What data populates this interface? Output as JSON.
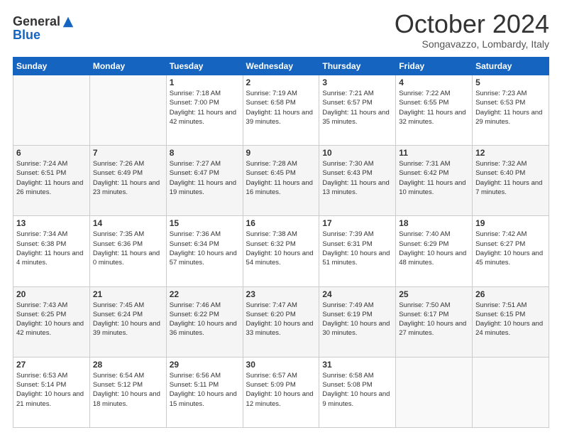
{
  "logo": {
    "general": "General",
    "blue": "Blue"
  },
  "header": {
    "month": "October 2024",
    "location": "Songavazzo, Lombardy, Italy"
  },
  "weekdays": [
    "Sunday",
    "Monday",
    "Tuesday",
    "Wednesday",
    "Thursday",
    "Friday",
    "Saturday"
  ],
  "weeks": [
    [
      {
        "day": "",
        "info": ""
      },
      {
        "day": "",
        "info": ""
      },
      {
        "day": "1",
        "info": "Sunrise: 7:18 AM\nSunset: 7:00 PM\nDaylight: 11 hours and 42 minutes."
      },
      {
        "day": "2",
        "info": "Sunrise: 7:19 AM\nSunset: 6:58 PM\nDaylight: 11 hours and 39 minutes."
      },
      {
        "day": "3",
        "info": "Sunrise: 7:21 AM\nSunset: 6:57 PM\nDaylight: 11 hours and 35 minutes."
      },
      {
        "day": "4",
        "info": "Sunrise: 7:22 AM\nSunset: 6:55 PM\nDaylight: 11 hours and 32 minutes."
      },
      {
        "day": "5",
        "info": "Sunrise: 7:23 AM\nSunset: 6:53 PM\nDaylight: 11 hours and 29 minutes."
      }
    ],
    [
      {
        "day": "6",
        "info": "Sunrise: 7:24 AM\nSunset: 6:51 PM\nDaylight: 11 hours and 26 minutes."
      },
      {
        "day": "7",
        "info": "Sunrise: 7:26 AM\nSunset: 6:49 PM\nDaylight: 11 hours and 23 minutes."
      },
      {
        "day": "8",
        "info": "Sunrise: 7:27 AM\nSunset: 6:47 PM\nDaylight: 11 hours and 19 minutes."
      },
      {
        "day": "9",
        "info": "Sunrise: 7:28 AM\nSunset: 6:45 PM\nDaylight: 11 hours and 16 minutes."
      },
      {
        "day": "10",
        "info": "Sunrise: 7:30 AM\nSunset: 6:43 PM\nDaylight: 11 hours and 13 minutes."
      },
      {
        "day": "11",
        "info": "Sunrise: 7:31 AM\nSunset: 6:42 PM\nDaylight: 11 hours and 10 minutes."
      },
      {
        "day": "12",
        "info": "Sunrise: 7:32 AM\nSunset: 6:40 PM\nDaylight: 11 hours and 7 minutes."
      }
    ],
    [
      {
        "day": "13",
        "info": "Sunrise: 7:34 AM\nSunset: 6:38 PM\nDaylight: 11 hours and 4 minutes."
      },
      {
        "day": "14",
        "info": "Sunrise: 7:35 AM\nSunset: 6:36 PM\nDaylight: 11 hours and 0 minutes."
      },
      {
        "day": "15",
        "info": "Sunrise: 7:36 AM\nSunset: 6:34 PM\nDaylight: 10 hours and 57 minutes."
      },
      {
        "day": "16",
        "info": "Sunrise: 7:38 AM\nSunset: 6:32 PM\nDaylight: 10 hours and 54 minutes."
      },
      {
        "day": "17",
        "info": "Sunrise: 7:39 AM\nSunset: 6:31 PM\nDaylight: 10 hours and 51 minutes."
      },
      {
        "day": "18",
        "info": "Sunrise: 7:40 AM\nSunset: 6:29 PM\nDaylight: 10 hours and 48 minutes."
      },
      {
        "day": "19",
        "info": "Sunrise: 7:42 AM\nSunset: 6:27 PM\nDaylight: 10 hours and 45 minutes."
      }
    ],
    [
      {
        "day": "20",
        "info": "Sunrise: 7:43 AM\nSunset: 6:25 PM\nDaylight: 10 hours and 42 minutes."
      },
      {
        "day": "21",
        "info": "Sunrise: 7:45 AM\nSunset: 6:24 PM\nDaylight: 10 hours and 39 minutes."
      },
      {
        "day": "22",
        "info": "Sunrise: 7:46 AM\nSunset: 6:22 PM\nDaylight: 10 hours and 36 minutes."
      },
      {
        "day": "23",
        "info": "Sunrise: 7:47 AM\nSunset: 6:20 PM\nDaylight: 10 hours and 33 minutes."
      },
      {
        "day": "24",
        "info": "Sunrise: 7:49 AM\nSunset: 6:19 PM\nDaylight: 10 hours and 30 minutes."
      },
      {
        "day": "25",
        "info": "Sunrise: 7:50 AM\nSunset: 6:17 PM\nDaylight: 10 hours and 27 minutes."
      },
      {
        "day": "26",
        "info": "Sunrise: 7:51 AM\nSunset: 6:15 PM\nDaylight: 10 hours and 24 minutes."
      }
    ],
    [
      {
        "day": "27",
        "info": "Sunrise: 6:53 AM\nSunset: 5:14 PM\nDaylight: 10 hours and 21 minutes."
      },
      {
        "day": "28",
        "info": "Sunrise: 6:54 AM\nSunset: 5:12 PM\nDaylight: 10 hours and 18 minutes."
      },
      {
        "day": "29",
        "info": "Sunrise: 6:56 AM\nSunset: 5:11 PM\nDaylight: 10 hours and 15 minutes."
      },
      {
        "day": "30",
        "info": "Sunrise: 6:57 AM\nSunset: 5:09 PM\nDaylight: 10 hours and 12 minutes."
      },
      {
        "day": "31",
        "info": "Sunrise: 6:58 AM\nSunset: 5:08 PM\nDaylight: 10 hours and 9 minutes."
      },
      {
        "day": "",
        "info": ""
      },
      {
        "day": "",
        "info": ""
      }
    ]
  ]
}
